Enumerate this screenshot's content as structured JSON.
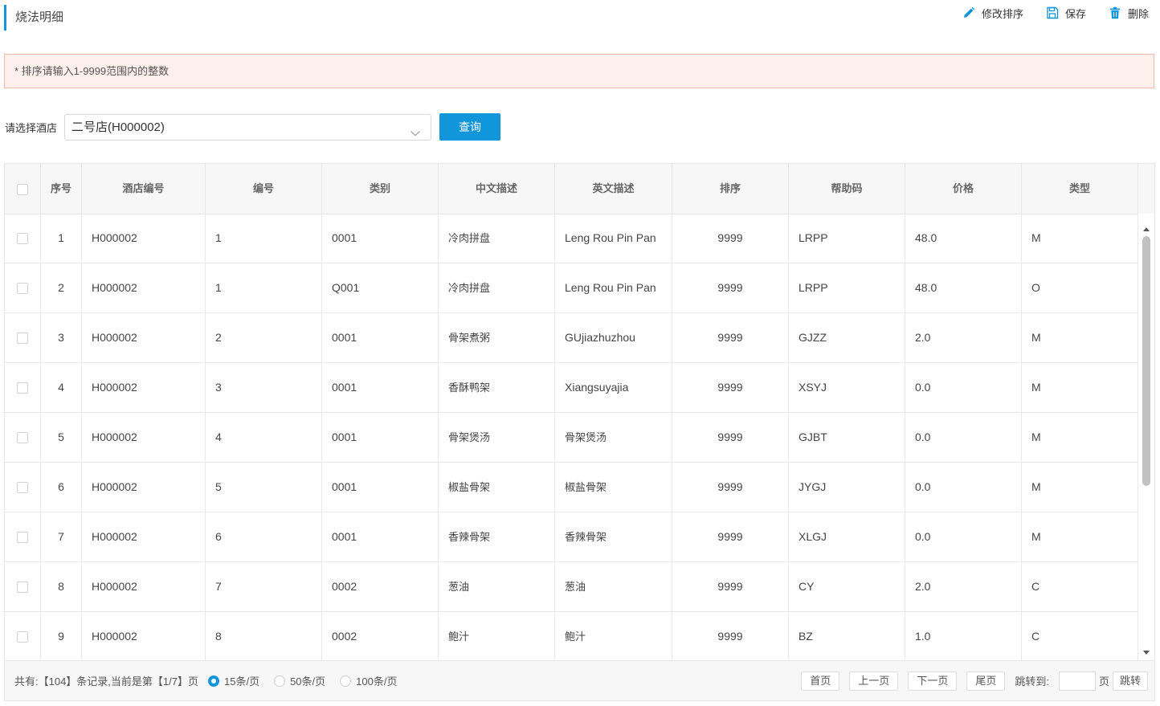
{
  "page": {
    "title": "烧法明细"
  },
  "toolbar": {
    "modify_sort": "修改排序",
    "save": "保存",
    "delete": "删除",
    "icon_color": "#1296db"
  },
  "notice": {
    "text": "* 排序请输入1-9999范围内的整数"
  },
  "filter": {
    "label": "请选择酒店",
    "selected": "二号店(H000002)",
    "query_button": "查询"
  },
  "table": {
    "headers": [
      "序号",
      "酒店编号",
      "编号",
      "类别",
      "中文描述",
      "英文描述",
      "排序",
      "帮助码",
      "价格",
      "类型"
    ],
    "rows": [
      {
        "no": "1",
        "hotel": "H000002",
        "code": "1",
        "cat": "0001",
        "cn": "冷肉拼盘",
        "en": "Leng Rou Pin Pan",
        "sort": "9999",
        "help": "LRPP",
        "price": "48.0",
        "type": "M"
      },
      {
        "no": "2",
        "hotel": "H000002",
        "code": "1",
        "cat": "Q001",
        "cn": "冷肉拼盘",
        "en": "Leng Rou Pin Pan",
        "sort": "9999",
        "help": "LRPP",
        "price": "48.0",
        "type": "O"
      },
      {
        "no": "3",
        "hotel": "H000002",
        "code": "2",
        "cat": "0001",
        "cn": "骨架煮粥",
        "en": "GUjiazhuzhou",
        "sort": "9999",
        "help": "GJZZ",
        "price": "2.0",
        "type": "M"
      },
      {
        "no": "4",
        "hotel": "H000002",
        "code": "3",
        "cat": "0001",
        "cn": "香酥鸭架",
        "en": "Xiangsuyajia",
        "sort": "9999",
        "help": "XSYJ",
        "price": "0.0",
        "type": "M"
      },
      {
        "no": "5",
        "hotel": "H000002",
        "code": "4",
        "cat": "0001",
        "cn": "骨架煲汤",
        "en": "骨架煲汤",
        "sort": "9999",
        "help": "GJBT",
        "price": "0.0",
        "type": "M"
      },
      {
        "no": "6",
        "hotel": "H000002",
        "code": "5",
        "cat": "0001",
        "cn": "椒盐骨架",
        "en": "椒盐骨架",
        "sort": "9999",
        "help": "JYGJ",
        "price": "0.0",
        "type": "M"
      },
      {
        "no": "7",
        "hotel": "H000002",
        "code": "6",
        "cat": "0001",
        "cn": "香辣骨架",
        "en": "香辣骨架",
        "sort": "9999",
        "help": "XLGJ",
        "price": "0.0",
        "type": "M"
      },
      {
        "no": "8",
        "hotel": "H000002",
        "code": "7",
        "cat": "0002",
        "cn": "葱油",
        "en": "葱油",
        "sort": "9999",
        "help": "CY",
        "price": "2.0",
        "type": "C"
      },
      {
        "no": "9",
        "hotel": "H000002",
        "code": "8",
        "cat": "0002",
        "cn": "鲍汁",
        "en": "鲍汁",
        "sort": "9999",
        "help": "BZ",
        "price": "1.0",
        "type": "C"
      }
    ]
  },
  "footer": {
    "summary": "共有:【104】条记录,当前是第【1/7】页",
    "page_sizes": [
      "15条/页",
      "50条/页",
      "100条/页"
    ],
    "selected_page_size": "15条/页",
    "first": "首页",
    "prev": "上一页",
    "next": "下一页",
    "last": "尾页",
    "jump_label": "跳转到:",
    "page_unit": "页",
    "jump_button": "跳转"
  }
}
